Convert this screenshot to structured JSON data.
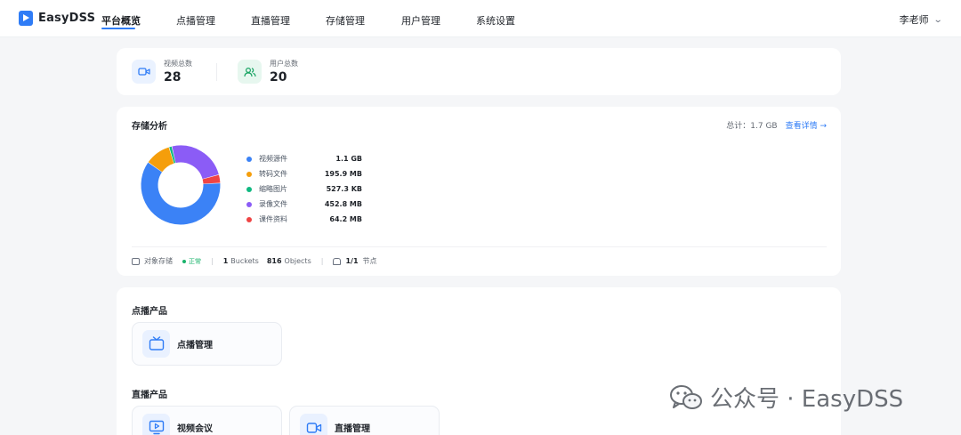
{
  "app": {
    "name": "EasyDSS"
  },
  "nav": {
    "items": [
      {
        "label": "平台概览",
        "active": true
      },
      {
        "label": "点播管理"
      },
      {
        "label": "直播管理"
      },
      {
        "label": "存储管理"
      },
      {
        "label": "用户管理"
      },
      {
        "label": "系统设置"
      }
    ],
    "user": "李老师"
  },
  "stats": [
    {
      "label": "视频总数",
      "value": "28",
      "icon": "video-camera-icon"
    },
    {
      "label": "用户总数",
      "value": "20",
      "icon": "users-icon"
    }
  ],
  "storage": {
    "title": "存储分析",
    "total_label": "总计：1.7 GB",
    "detail_link": "查看详情 →",
    "items": [
      {
        "name": "视频源件",
        "value": "1.1 GB",
        "color": "#3b82f6",
        "bytes_mb": 1126.4
      },
      {
        "name": "转码文件",
        "value": "195.9 MB",
        "color": "#f59e0b",
        "bytes_mb": 195.9
      },
      {
        "name": "缩略图片",
        "value": "527.3 KB",
        "color": "#10b981",
        "bytes_mb": 0.515
      },
      {
        "name": "录像文件",
        "value": "452.8 MB",
        "color": "#8b5cf6",
        "bytes_mb": 452.8
      },
      {
        "name": "课件资料",
        "value": "64.2 MB",
        "color": "#ef4444",
        "bytes_mb": 64.2
      }
    ],
    "footer": {
      "type": "对象存储",
      "status": "正常",
      "buckets_count": "1",
      "buckets_label": "Buckets",
      "objects_count": "816",
      "objects_label": "Objects",
      "nodes_count": "1/1",
      "nodes_label": "节点"
    }
  },
  "vod_section": {
    "title": "点播产品",
    "products": [
      {
        "label": "点播管理",
        "icon": "tv-icon"
      }
    ]
  },
  "live_section": {
    "title": "直播产品",
    "products": [
      {
        "label": "视频会议",
        "icon": "monitor-play-icon"
      },
      {
        "label": "直播管理",
        "icon": "video-camera-icon"
      }
    ]
  },
  "watermark": {
    "text": "公众号 · EasyDSS"
  }
}
